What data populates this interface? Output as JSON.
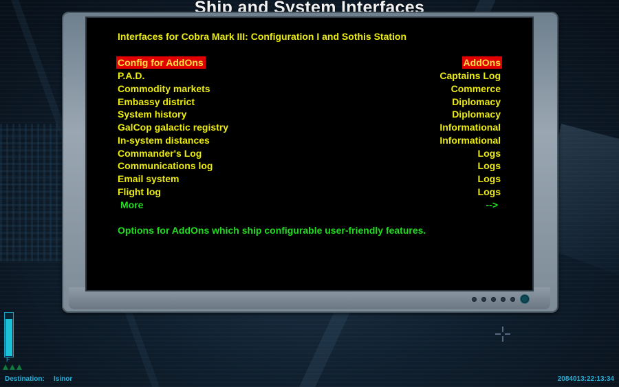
{
  "header": {
    "title": "Ship and System Interfaces"
  },
  "panel": {
    "subtitle": "Interfaces for Cobra Mark III: Configuration I and Sothis Station",
    "items": [
      {
        "label": "Config for AddOns",
        "category": "AddOns",
        "selected": true
      },
      {
        "label": "P.A.D.",
        "category": "Captains Log"
      },
      {
        "label": "Commodity markets",
        "category": "Commerce"
      },
      {
        "label": "Embassy district",
        "category": "Diplomacy"
      },
      {
        "label": "System history",
        "category": "Diplomacy"
      },
      {
        "label": "GalCop galactic registry",
        "category": "Informational"
      },
      {
        "label": "In-system distances",
        "category": "Informational"
      },
      {
        "label": "Commander's Log",
        "category": "Logs"
      },
      {
        "label": "Communications log",
        "category": "Logs"
      },
      {
        "label": "Email system",
        "category": "Logs"
      },
      {
        "label": "Flight log",
        "category": "Logs"
      }
    ],
    "more": {
      "label": "More",
      "arrow": "-->"
    },
    "description": "Options for AddOns which ship configurable user-friendly features."
  },
  "hud": {
    "fuel_label": "F",
    "fuel_level": 0.85,
    "destination_label": "Destination:",
    "destination_value": "Isinor",
    "clock": "2084013:22:13:34"
  },
  "colors": {
    "menu_text": "#ecec10",
    "selected_bg": "#e00000",
    "more_text": "#22dd22",
    "hud_text": "#29b0d8"
  }
}
